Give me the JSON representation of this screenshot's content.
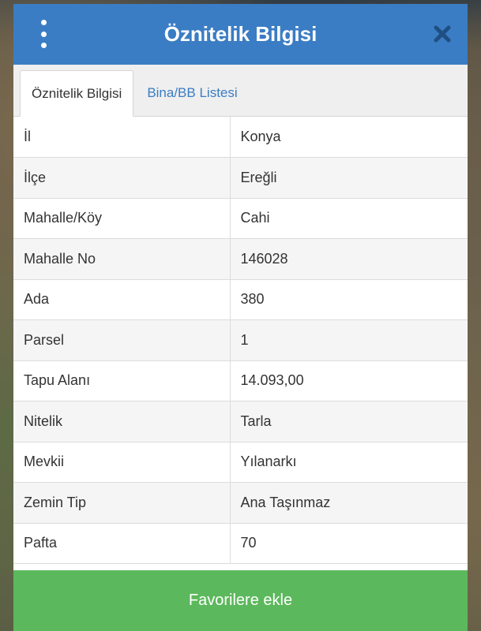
{
  "dialog": {
    "title": "Öznitelik Bilgisi",
    "icons": {
      "menu": "more-vertical-icon",
      "close": "close-icon"
    },
    "colors": {
      "header": "#3a7dc4",
      "button": "#5cb85c",
      "tab_link": "#3a7dc4"
    }
  },
  "tabs": [
    {
      "label": "Öznitelik Bilgisi",
      "active": true
    },
    {
      "label": "Bina/BB Listesi",
      "active": false
    }
  ],
  "rows": [
    {
      "key": "İl",
      "value": "Konya"
    },
    {
      "key": "İlçe",
      "value": "Ereğli"
    },
    {
      "key": "Mahalle/Köy",
      "value": "Cahi"
    },
    {
      "key": "Mahalle No",
      "value": "146028"
    },
    {
      "key": "Ada",
      "value": "380"
    },
    {
      "key": "Parsel",
      "value": "1"
    },
    {
      "key": "Tapu Alanı",
      "value": "14.093,00"
    },
    {
      "key": "Nitelik",
      "value": "Tarla"
    },
    {
      "key": "Mevkii",
      "value": "Yılanarkı"
    },
    {
      "key": "Zemin Tip",
      "value": "Ana Taşınmaz"
    },
    {
      "key": "Pafta",
      "value": "70"
    }
  ],
  "footer": {
    "button_label": "Favorilere ekle"
  }
}
